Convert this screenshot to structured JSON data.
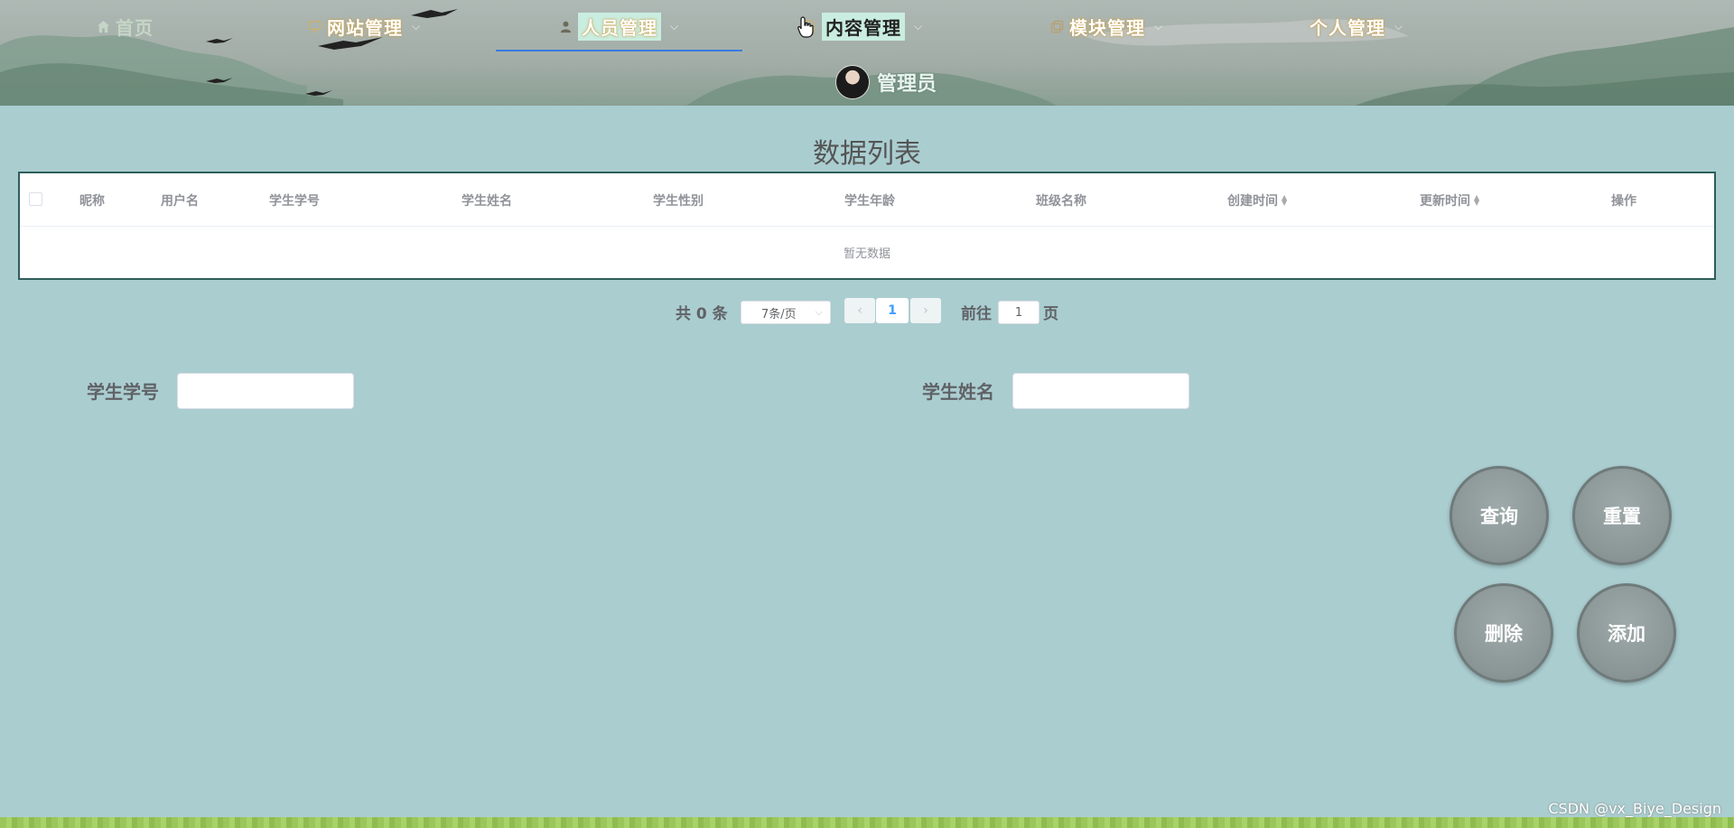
{
  "nav": {
    "items": [
      {
        "label": "首页",
        "icon": "home-icon"
      },
      {
        "label": "网站管理",
        "icon": "monitor-icon"
      },
      {
        "label": "人员管理",
        "icon": "user-icon"
      },
      {
        "label": "内容管理",
        "icon": "document-icon"
      },
      {
        "label": "模块管理",
        "icon": "copy-icon"
      },
      {
        "label": "个人管理",
        "icon": ""
      }
    ],
    "active": "人员管理"
  },
  "admin": {
    "name": "管理员"
  },
  "table": {
    "title": "数据列表",
    "columns": [
      "昵称",
      "用户名",
      "学生学号",
      "学生姓名",
      "学生性别",
      "学生年龄",
      "班级名称",
      "创建时间",
      "更新时间",
      "操作"
    ],
    "empty_text": "暂无数据"
  },
  "pagination": {
    "total_text": "共 0 条",
    "page_size": "7条/页",
    "current_page": "1",
    "goto_label": "前往",
    "goto_value": "1",
    "page_suffix": "页"
  },
  "search": {
    "fields": [
      {
        "label": "学生学号",
        "value": ""
      },
      {
        "label": "学生姓名",
        "value": ""
      }
    ]
  },
  "buttons": {
    "query": "查询",
    "reset": "重置",
    "delete": "删除",
    "add": "添加"
  },
  "watermark": "CSDN @vx_Biye_Design",
  "colors": {
    "background": "#aacdd0",
    "table_border": "#2f5e5b",
    "accent": "#409eff",
    "underline": "#3a7be0"
  }
}
